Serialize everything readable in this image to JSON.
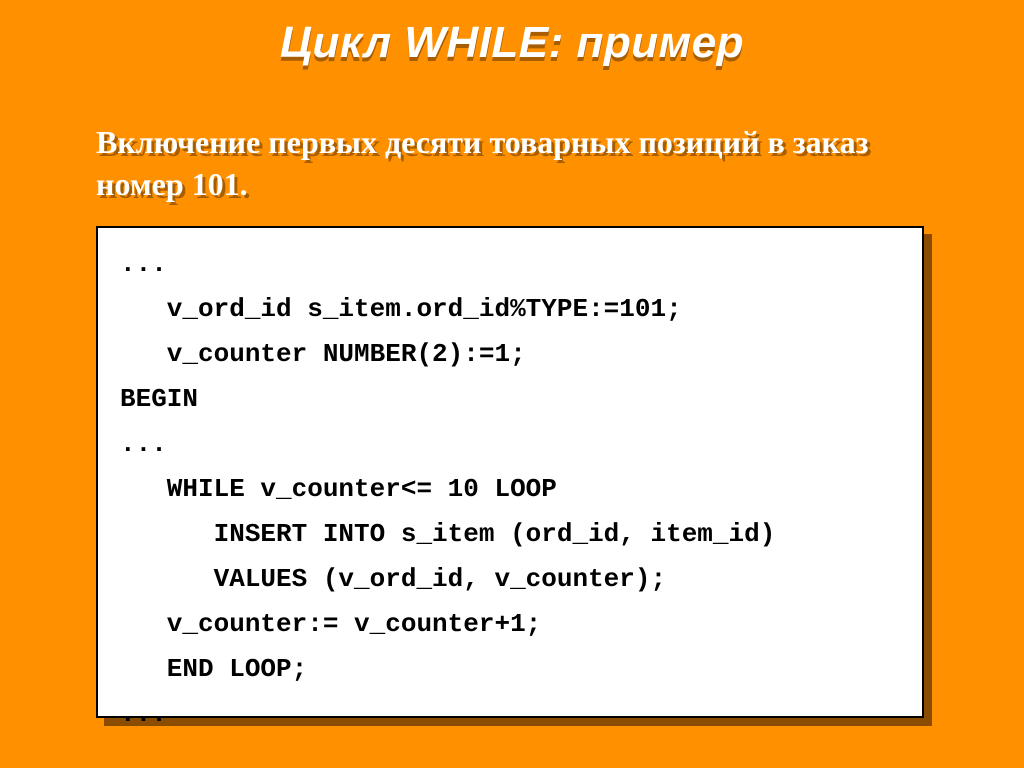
{
  "slide": {
    "title": "Цикл WHILE: пример",
    "subtitle": "Включение первых десяти товарных позиций в заказ номер 101.",
    "code": "...\n   v_ord_id s_item.ord_id%TYPE:=101;\n   v_counter NUMBER(2):=1;\nBEGIN\n...\n   WHILE v_counter<= 10 LOOP\n      INSERT INTO s_item (ord_id, item_id)\n      VALUES (v_ord_id, v_counter);\n   v_counter:= v_counter+1;\n   END LOOP;\n..."
  }
}
